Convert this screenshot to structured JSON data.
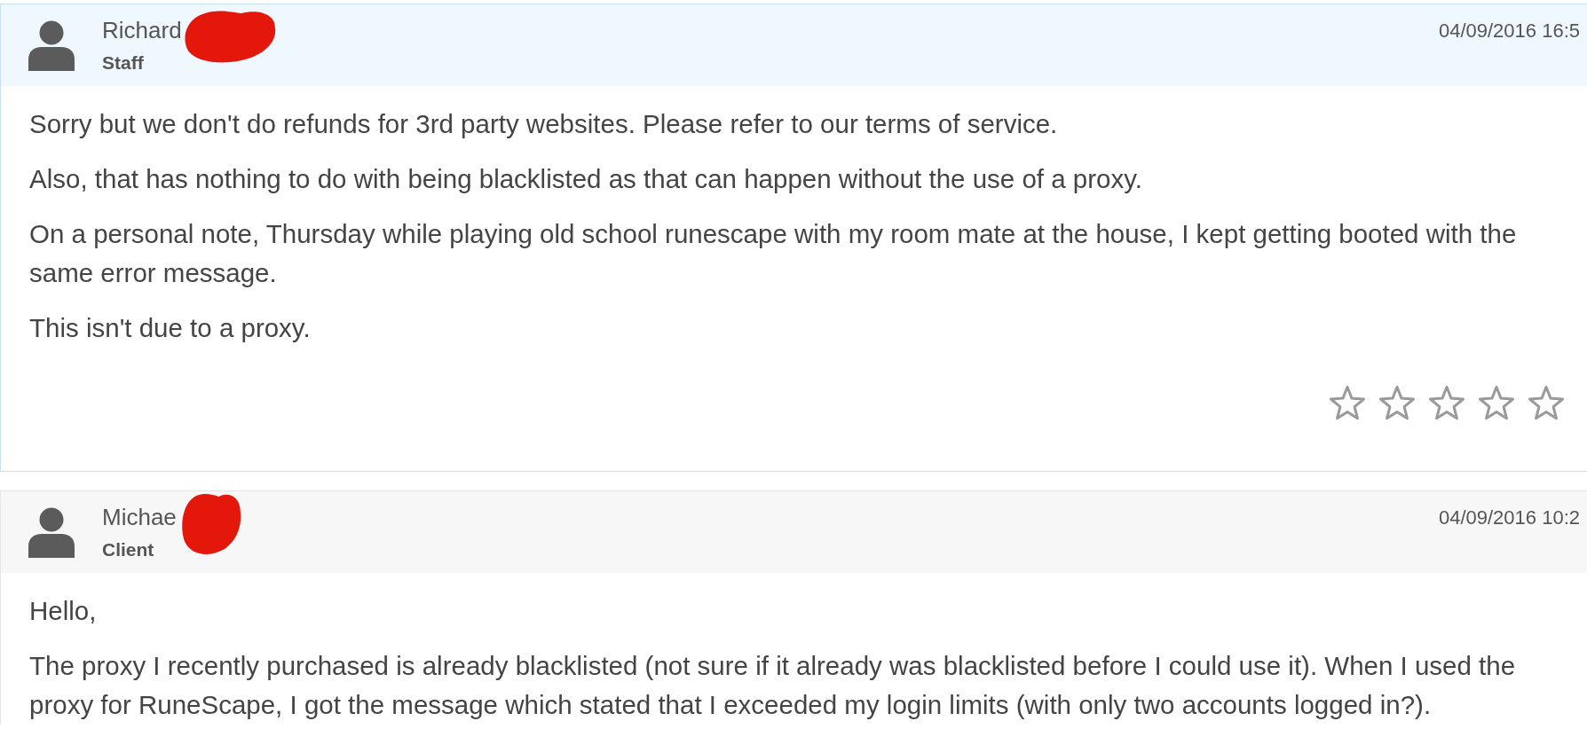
{
  "posts": [
    {
      "kind": "staff",
      "author": {
        "name": "Richard",
        "role": "Staff",
        "redacted": true
      },
      "date": "04/09/2016 16:5",
      "paragraphs": [
        "Sorry but we don't do refunds for 3rd party websites. Please refer to our terms of service.",
        "Also, that has nothing to do with being blacklisted as that can happen without the use of a proxy.",
        "On a personal note, Thursday while playing old school runescape with my room mate at the house, I kept getting booted with the same error message.",
        "This isn't due to a proxy."
      ],
      "rating": {
        "stars": 0
      }
    },
    {
      "kind": "client",
      "author": {
        "name": "Michae",
        "role": "Client",
        "redacted": true
      },
      "date": "04/09/2016 10:2",
      "paragraphs": [
        "Hello,",
        "The proxy I recently purchased is already blacklisted (not sure if it already was blacklisted before I could use it). When I used the proxy for RuneScape, I got the message which stated that I exceeded my login limits (with only two accounts logged in?)."
      ]
    }
  ]
}
